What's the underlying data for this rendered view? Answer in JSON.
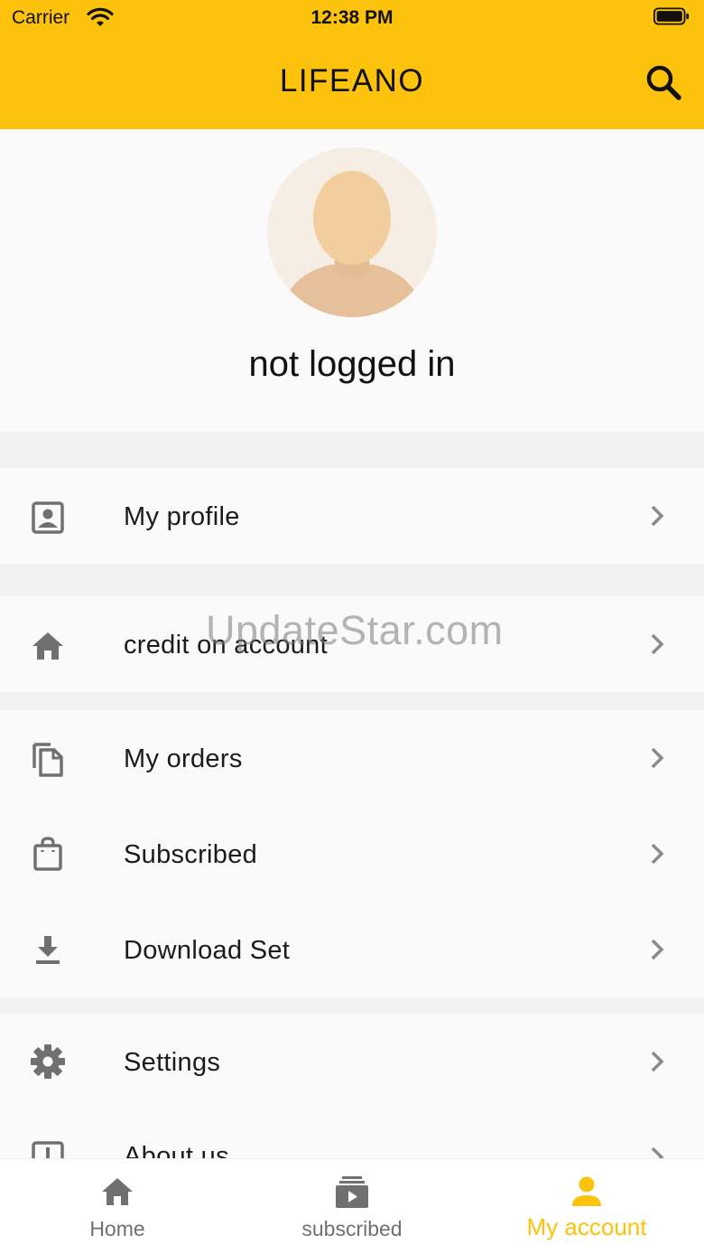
{
  "status_bar": {
    "carrier": "Carrier",
    "time": "12:38 PM"
  },
  "app_bar": {
    "title": "LIFEANO",
    "search_icon": "search-icon"
  },
  "profile": {
    "status_text": "not logged in",
    "avatar_icon": "avatar-placeholder"
  },
  "menu": {
    "my_profile": "My profile",
    "credit": "credit on account",
    "orders": "My orders",
    "subscribed": "Subscribed",
    "download": "Download Set",
    "settings": "Settings",
    "about": "About us"
  },
  "watermark": "UpdateStar.com",
  "tabs": {
    "home": "Home",
    "subscribed": "subscribed",
    "account": "My account",
    "active": "account"
  },
  "colors": {
    "accent": "#fdc20b",
    "icon_gray": "#707070",
    "chevron": "#8a8a8a"
  }
}
